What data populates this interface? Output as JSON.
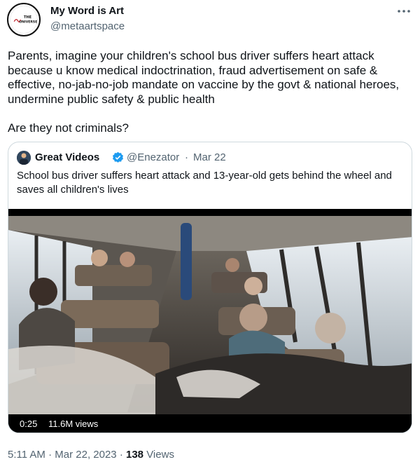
{
  "author": {
    "name": "My Word is Art",
    "handle": "@metaartspace",
    "avatar_text": {
      "line1": "THE",
      "line2": "UNIVERSE"
    }
  },
  "more_icon": "more-horizontal-icon",
  "tweet": {
    "text": "Parents, imagine your children's school bus driver suffers heart attack because u know medical indoctrination, fraud advertisement on safe & effective, no-jab-no-job mandate on vaccine by the govt & national heroes, undermine public safety & public health\n\nAre they not criminals?"
  },
  "quoted": {
    "name": "Great Videos",
    "verified_icon": "verified-badge-icon",
    "handle": "@Enezator",
    "separator": "·",
    "date": "Mar 22",
    "text": "School bus driver suffers heart attack and 13-year-old gets behind the wheel and saves all children's lives",
    "video": {
      "duration": "0:25",
      "views": "11.6M views"
    }
  },
  "meta": {
    "time": "5:11 AM",
    "separator": "·",
    "date": "Mar 22, 2023",
    "views_count": "138",
    "views_label": "Views"
  },
  "colors": {
    "text": "#0f1419",
    "secondary": "#536471",
    "border": "#cfd9de",
    "verified": "#1d9bf0"
  }
}
